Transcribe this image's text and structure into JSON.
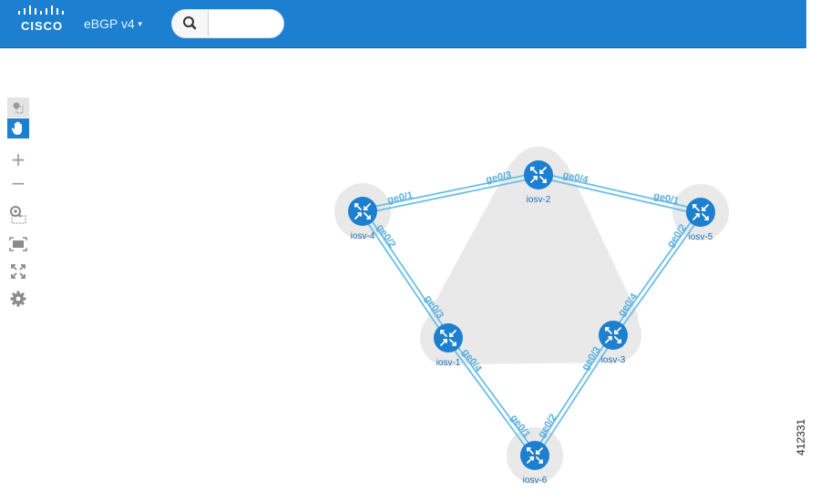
{
  "header": {
    "logo_text": "CISCO",
    "topology_name": "eBGP v4",
    "search": {
      "value": "",
      "placeholder": ""
    }
  },
  "toolbar": {
    "zoom_in_label": "+",
    "zoom_out_label": "−",
    "tools": [
      "select-icon",
      "pan-hand-icon",
      "zoom-in-icon",
      "zoom-out-icon",
      "zoom-selection-icon",
      "fit-view-icon",
      "fullscreen-icon",
      "settings-gear-icon"
    ]
  },
  "topology": {
    "nodes": [
      {
        "id": "iosv-2",
        "label": "iosv-2"
      },
      {
        "id": "iosv-4",
        "label": "iosv-4"
      },
      {
        "id": "iosv-5",
        "label": "iosv-5"
      },
      {
        "id": "iosv-1",
        "label": "iosv-1"
      },
      {
        "id": "iosv-3",
        "label": "iosv-3"
      },
      {
        "id": "iosv-6",
        "label": "iosv-6"
      }
    ],
    "links": [
      {
        "from": "iosv-4",
        "to": "iosv-2",
        "from_if": "ge0/1",
        "to_if": "ge0/3"
      },
      {
        "from": "iosv-2",
        "to": "iosv-5",
        "from_if": "ge0/4",
        "to_if": "ge0/1"
      },
      {
        "from": "iosv-4",
        "to": "iosv-1",
        "from_if": "ge0/2",
        "to_if": "ge0/3"
      },
      {
        "from": "iosv-5",
        "to": "iosv-3",
        "from_if": "ge0/2",
        "to_if": "ge0/4"
      },
      {
        "from": "iosv-1",
        "to": "iosv-6",
        "from_if": "ge0/4",
        "to_if": "ge0/1"
      },
      {
        "from": "iosv-3",
        "to": "iosv-6",
        "from_if": "ge0/3",
        "to_if": "ge0/2"
      }
    ],
    "colors": {
      "node": "#1d7fd0",
      "link": "#6cbfe6",
      "group": "#e9e9e9"
    }
  },
  "figure_id": "412331"
}
